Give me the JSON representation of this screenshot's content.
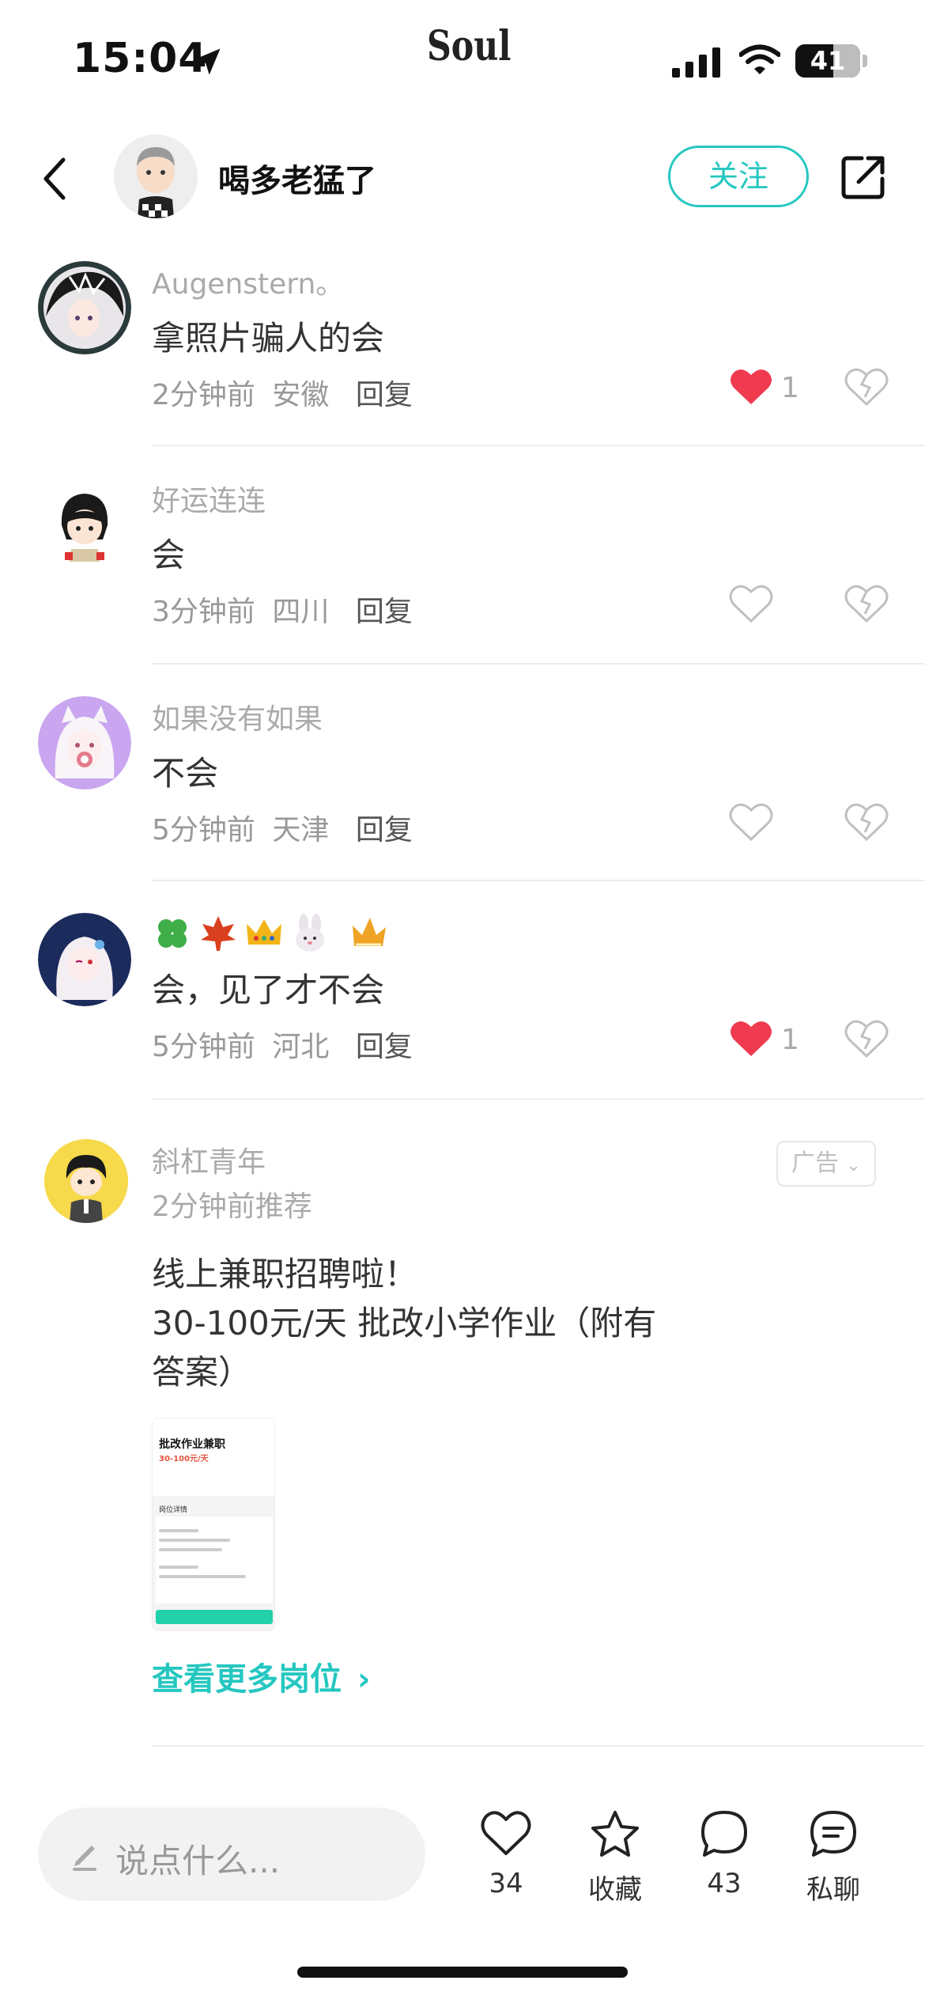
{
  "status_bar": {
    "time": "15:04",
    "battery": "41",
    "app_logo": "Soul"
  },
  "header": {
    "user_name": "喝多老猛了",
    "follow_label": "关注",
    "back_icon": "chevron-left-icon",
    "share_icon": "share-external-icon"
  },
  "comments": [
    {
      "name": "Augenstern。",
      "text": "拿照片骗人的会",
      "time": "2分钟前",
      "location": "安徽",
      "reply_label": "回复",
      "liked": true,
      "likes": "1"
    },
    {
      "name": "好运连连",
      "text": "会",
      "time": "3分钟前",
      "location": "四川",
      "reply_label": "回复",
      "liked": false,
      "likes": ""
    },
    {
      "name": "如果没有如果",
      "text": "不会",
      "time": "5分钟前",
      "location": "天津",
      "reply_label": "回复",
      "liked": false,
      "likes": ""
    },
    {
      "name": "",
      "name_emojis": [
        "four-leaf-clover",
        "maple-leaf",
        "crown",
        "rabbit-face",
        "gold-crown"
      ],
      "text": "会，见了才不会",
      "time": "5分钟前",
      "location": "河北",
      "reply_label": "回复",
      "liked": true,
      "likes": "1"
    }
  ],
  "ad": {
    "name": "斜杠青年",
    "time": "2分钟前推荐",
    "badge": "广告",
    "text_lines": [
      "线上兼职招聘啦！",
      "30-100元/天 批改小学作业（附有",
      "答案）"
    ],
    "image": {
      "title": "批改作业兼职",
      "salary": "30-100元/天",
      "section": "岗位详情"
    },
    "more_label": "查看更多岗位"
  },
  "bottom_bar": {
    "input_placeholder": "说点什么...",
    "like_count": "34",
    "collect_label": "收藏",
    "comment_count": "43",
    "chat_label": "私聊"
  },
  "colors": {
    "accent": "#25c7c0",
    "like_red": "#ef3a4f",
    "muted": "#aaaaaa"
  }
}
